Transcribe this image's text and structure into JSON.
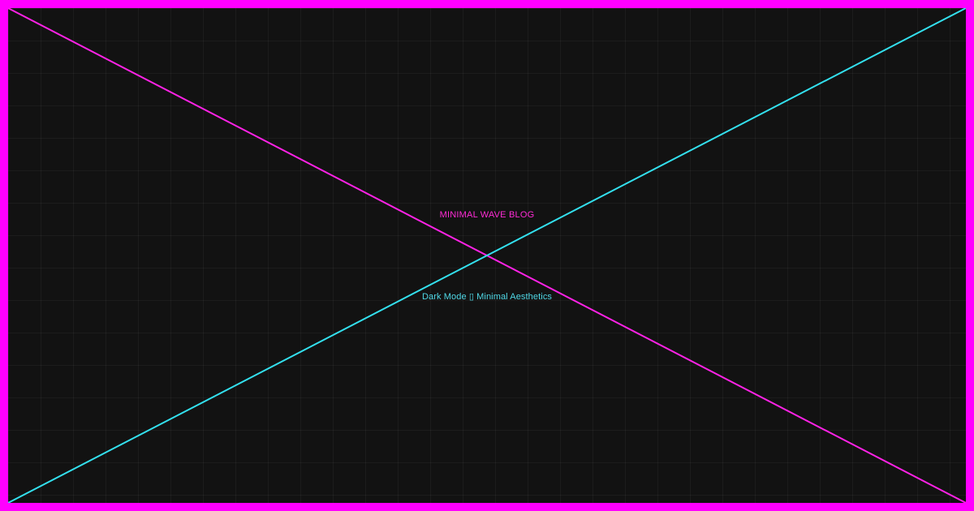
{
  "blog": {
    "title": "MINIMAL WAVE BLOG",
    "subtitle": "Dark Mode ▯ Minimal Aesthetics"
  },
  "colors": {
    "border": "#ff00ff",
    "background": "#121212",
    "title": "#ff2bd6",
    "subtitle": "#4fd8e6",
    "line_descending": "#ff22e6",
    "line_ascending": "#33e0ee"
  }
}
